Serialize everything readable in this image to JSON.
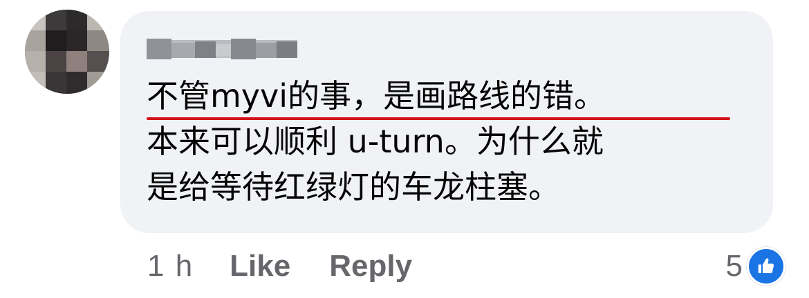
{
  "comment": {
    "lines": [
      "不管myvi的事，是画路线的错。",
      "本来可以顺利 u-turn。为什么就",
      "是给等待红绿灯的车龙柱塞。"
    ],
    "timestamp": "1 h",
    "actions": {
      "like_label": "Like",
      "reply_label": "Reply"
    },
    "reactions": {
      "count": "5",
      "icon": "like-thumbs-up-icon",
      "badge_color": "#1b74e4"
    },
    "spellcheck_color": "#d2131a"
  }
}
